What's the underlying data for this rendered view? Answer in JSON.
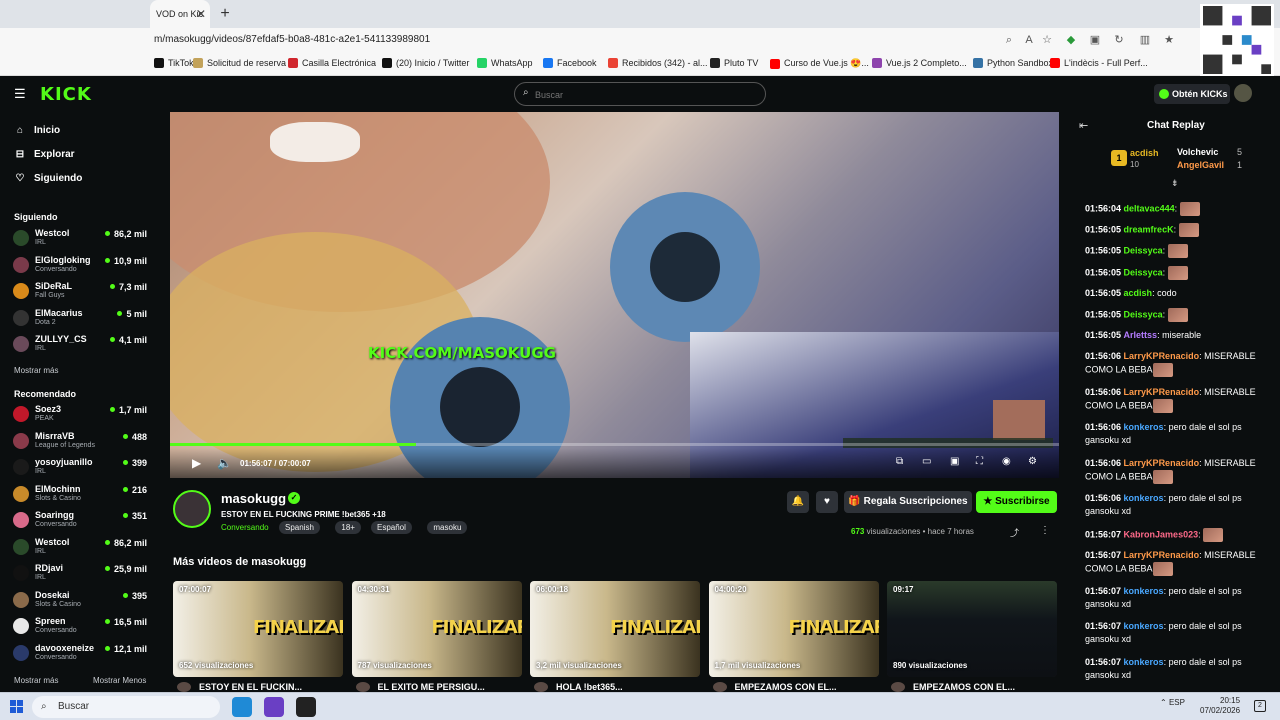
{
  "browser": {
    "tab_title": "VOD on Kic",
    "url": "m/masokugg/videos/87efdaf5-b0a8-481c-a2e1-541133989801",
    "bookmarks": [
      {
        "label": "TikTok",
        "color": "#111111"
      },
      {
        "label": "Solicitud de reserva",
        "color": "#c2a25a"
      },
      {
        "label": "Casilla Electrónica",
        "color": "#d0262d"
      },
      {
        "label": "(20) Inicio / Twitter",
        "color": "#111111"
      },
      {
        "label": "WhatsApp",
        "color": "#25d366"
      },
      {
        "label": "Facebook",
        "color": "#1877f2"
      },
      {
        "label": "Recibidos (342) - al...",
        "color": "#ea4335"
      },
      {
        "label": "Pluto TV",
        "color": "#222222"
      },
      {
        "label": "Curso de Vue.js 😍...",
        "color": "#ff0000"
      },
      {
        "label": "Vue.js 2 Completo...",
        "color": "#8e44ad"
      },
      {
        "label": "Python Sandbox",
        "color": "#3572a5"
      },
      {
        "label": "L'indècis - Full Perf...",
        "color": "#ff0000"
      }
    ]
  },
  "nav": {
    "logo": "KICK",
    "search_placeholder": "Buscar",
    "get_kicks": "Obtén KICKs"
  },
  "sidebar": {
    "main": [
      {
        "label": "Inicio",
        "icon": "home-icon"
      },
      {
        "label": "Explorar",
        "icon": "browse-icon"
      },
      {
        "label": "Siguiendo",
        "icon": "heart-icon"
      }
    ],
    "following_header": "Siguiendo",
    "following": [
      {
        "name": "Westcol",
        "category": "IRL",
        "viewers": "86,2 mil",
        "color": "#2a4a2a"
      },
      {
        "name": "ElGlogloking",
        "category": "Conversando",
        "viewers": "10,9 mil",
        "color": "#7a3a4a"
      },
      {
        "name": "SiDeRaL",
        "category": "Fall Guys",
        "viewers": "7,3 mil",
        "color": "#d98a1a"
      },
      {
        "name": "ElMacarius",
        "category": "Dota 2",
        "viewers": "5 mil",
        "color": "#333333"
      },
      {
        "name": "ZULLYY_CS",
        "category": "IRL",
        "viewers": "4,1 mil",
        "color": "#6a4a5a"
      }
    ],
    "show_more_1": "Mostrar más",
    "recommended_header": "Recomendado",
    "recommended": [
      {
        "name": "Soez3",
        "category": "PEAK",
        "viewers": "1,7 mil",
        "color": "#c2182a"
      },
      {
        "name": "MisrraVB",
        "category": "League of Legends",
        "viewers": "488",
        "color": "#8a3a4a"
      },
      {
        "name": "yosoyjuanillo",
        "category": "IRL",
        "viewers": "399",
        "color": "#1a1a1a"
      },
      {
        "name": "ElMochinn",
        "category": "Slots & Casino",
        "viewers": "216",
        "color": "#c88a2a"
      },
      {
        "name": "Soaringg",
        "category": "Conversando",
        "viewers": "351",
        "color": "#d86a8a"
      },
      {
        "name": "Westcol",
        "category": "IRL",
        "viewers": "86,2 mil",
        "color": "#2a4a2a"
      },
      {
        "name": "RDjavi",
        "category": "IRL",
        "viewers": "25,9 mil",
        "color": "#111111"
      },
      {
        "name": "Dosekai",
        "category": "Slots & Casino",
        "viewers": "395",
        "color": "#8a6a4a"
      },
      {
        "name": "Spreen",
        "category": "Conversando",
        "viewers": "16,5 mil",
        "color": "#e8e8e8"
      },
      {
        "name": "davooxeneize",
        "category": "Conversando",
        "viewers": "12,1 mil",
        "color": "#2a3a6a"
      }
    ],
    "show_more_2": "Mostrar más",
    "show_less": "Mostrar Menos"
  },
  "player": {
    "time": "01:56:07 / 07:00:07",
    "progress": 0.277,
    "watermark": "KICK.COM/MASOKUGG"
  },
  "channel": {
    "name": "masokugg",
    "title": "ESTOY EN EL FUCKING PRIME !bet365 +18",
    "category": "Conversando",
    "tags": [
      "Spanish",
      "18+",
      "Español",
      "masoku"
    ],
    "gift_label": "Regala Suscripciones",
    "subscribe_label": "Suscribirse",
    "views_count": "673",
    "views_text": "visualizaciones",
    "time_ago": "hace 7 horas"
  },
  "more_videos": {
    "title": "Más videos de masokugg",
    "items": [
      {
        "duration": "07:00:07",
        "views": "652 visualizaciones",
        "title": "ESTOY EN EL FUCKIN..."
      },
      {
        "duration": "04:30:31",
        "views": "787 visualizaciones",
        "title": "EL EXITO ME PERSIGU..."
      },
      {
        "duration": "06:00:18",
        "views": "3,2 mil visualizaciones",
        "title": "HOLA !bet365..."
      },
      {
        "duration": "04:00:20",
        "views": "1,7 mil visualizaciones",
        "title": "EMPEZAMOS CON EL..."
      },
      {
        "duration": "09:17",
        "views": "890 visualizaciones",
        "title": "EMPEZAMOS CON EL..."
      }
    ],
    "thumb_text": "FINALIZAR"
  },
  "chat": {
    "title": "Chat Replay",
    "leaderboard": [
      {
        "rank": "1",
        "name": "acdish",
        "value": "10"
      },
      {
        "name": "Volchevic",
        "value": "5"
      },
      {
        "name": "AngelGavil",
        "value": "1"
      }
    ],
    "messages": [
      {
        "ts": "01:56:04",
        "user": "deltavac444",
        "color": "#53fc18",
        "text": "",
        "emote": true
      },
      {
        "ts": "01:56:05",
        "user": "dreamfrecK",
        "color": "#53fc18",
        "text": "",
        "emote": true
      },
      {
        "ts": "01:56:05",
        "user": "Deissyca",
        "color": "#53fc18",
        "text": "",
        "emote": true
      },
      {
        "ts": "01:56:05",
        "user": "Deissyca",
        "color": "#53fc18",
        "text": "",
        "emote": true
      },
      {
        "ts": "01:56:05",
        "user": "acdish",
        "color": "#53fc18",
        "text": "codo",
        "emote": false
      },
      {
        "ts": "01:56:05",
        "user": "Deissyca",
        "color": "#53fc18",
        "text": "",
        "emote": true
      },
      {
        "ts": "01:56:05",
        "user": "Arlettss",
        "color": "#b47cff",
        "text": "miserable",
        "emote": false
      },
      {
        "ts": "01:56:06",
        "user": "LarryKPRenacido",
        "color": "#ff9a4a",
        "text": "MISERABLE COMO LA BEBA",
        "emote": true
      },
      {
        "ts": "01:56:06",
        "user": "LarryKPRenacido",
        "color": "#ff9a4a",
        "text": "MISERABLE COMO LA BEBA",
        "emote": true
      },
      {
        "ts": "01:56:06",
        "user": "konkeros",
        "color": "#4aa8ff",
        "text": "pero dale el sol ps gansoku xd",
        "emote": false
      },
      {
        "ts": "01:56:06",
        "user": "LarryKPRenacido",
        "color": "#ff9a4a",
        "text": "MISERABLE COMO LA BEBA",
        "emote": true
      },
      {
        "ts": "01:56:06",
        "user": "konkeros",
        "color": "#4aa8ff",
        "text": "pero dale el sol ps gansoku xd",
        "emote": false
      },
      {
        "ts": "01:56:07",
        "user": "KabronJames023",
        "color": "#ff6a8a",
        "text": "",
        "emote": true
      },
      {
        "ts": "01:56:07",
        "user": "LarryKPRenacido",
        "color": "#ff9a4a",
        "text": "MISERABLE COMO LA BEBA",
        "emote": true
      },
      {
        "ts": "01:56:07",
        "user": "konkeros",
        "color": "#4aa8ff",
        "text": "pero dale el sol ps gansoku xd",
        "emote": false
      },
      {
        "ts": "01:56:07",
        "user": "konkeros",
        "color": "#4aa8ff",
        "text": "pero dale el sol ps gansoku xd",
        "emote": false
      },
      {
        "ts": "01:56:07",
        "user": "konkeros",
        "color": "#4aa8ff",
        "text": "pero dale el sol ps gansoku xd",
        "emote": false
      }
    ]
  },
  "taskbar": {
    "search": "Buscar",
    "lang": "ESP",
    "time": "20:15",
    "date": "07/02/2026",
    "notifications": "2"
  },
  "colors": {
    "accent": "#53fc18",
    "bg": "#0b0e0f"
  }
}
